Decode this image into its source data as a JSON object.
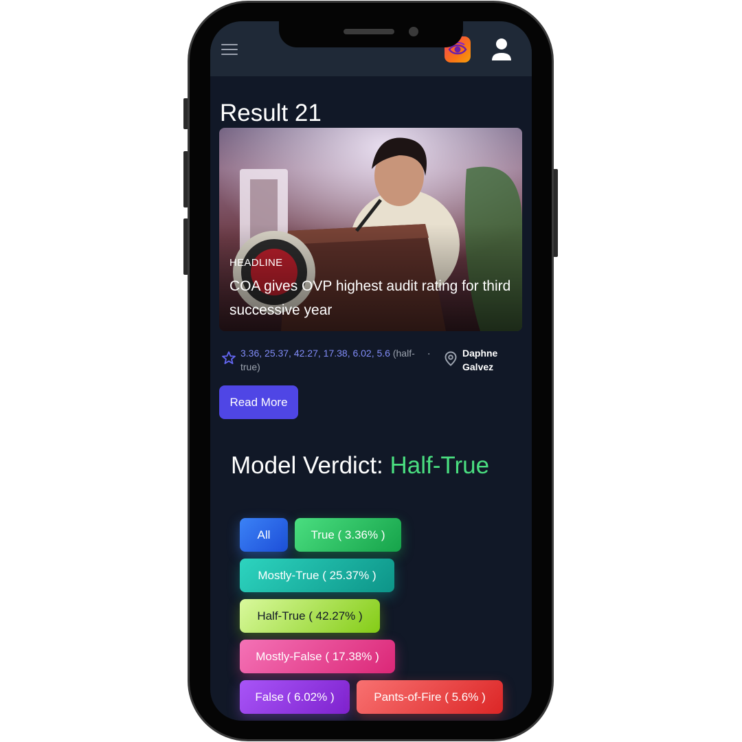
{
  "header": {
    "menu_icon": "hamburger-menu-icon",
    "logo_icon": "eye-logo-icon",
    "profile_icon": "user-profile-icon"
  },
  "page": {
    "title": "Result 21"
  },
  "article": {
    "tag": "HEADLINE",
    "headline": "COA gives OVP highest audit rating for third successive year",
    "scores": "3.36, 25.37, 42.27, 17.38, 6.02, 5.6",
    "score_label": "(half-true)",
    "separator": "·",
    "author": "Daphne Galvez",
    "read_more_label": "Read More"
  },
  "verdict": {
    "prefix": "Model Verdict:",
    "value": "Half-True",
    "value_color": "#4ade80"
  },
  "filters": {
    "all": "All",
    "true": "True ( 3.36% )",
    "mostly_true": "Mostly-True ( 25.37% )",
    "half_true": "Half-True ( 42.27% )",
    "mostly_false": "Mostly-False ( 17.38% )",
    "false": "False ( 6.02% )",
    "pants_on_fire": "Pants-of-Fire ( 5.6% )"
  },
  "colors": {
    "background": "#111827",
    "topbar": "#1f2937",
    "accent": "#4f46e5"
  }
}
